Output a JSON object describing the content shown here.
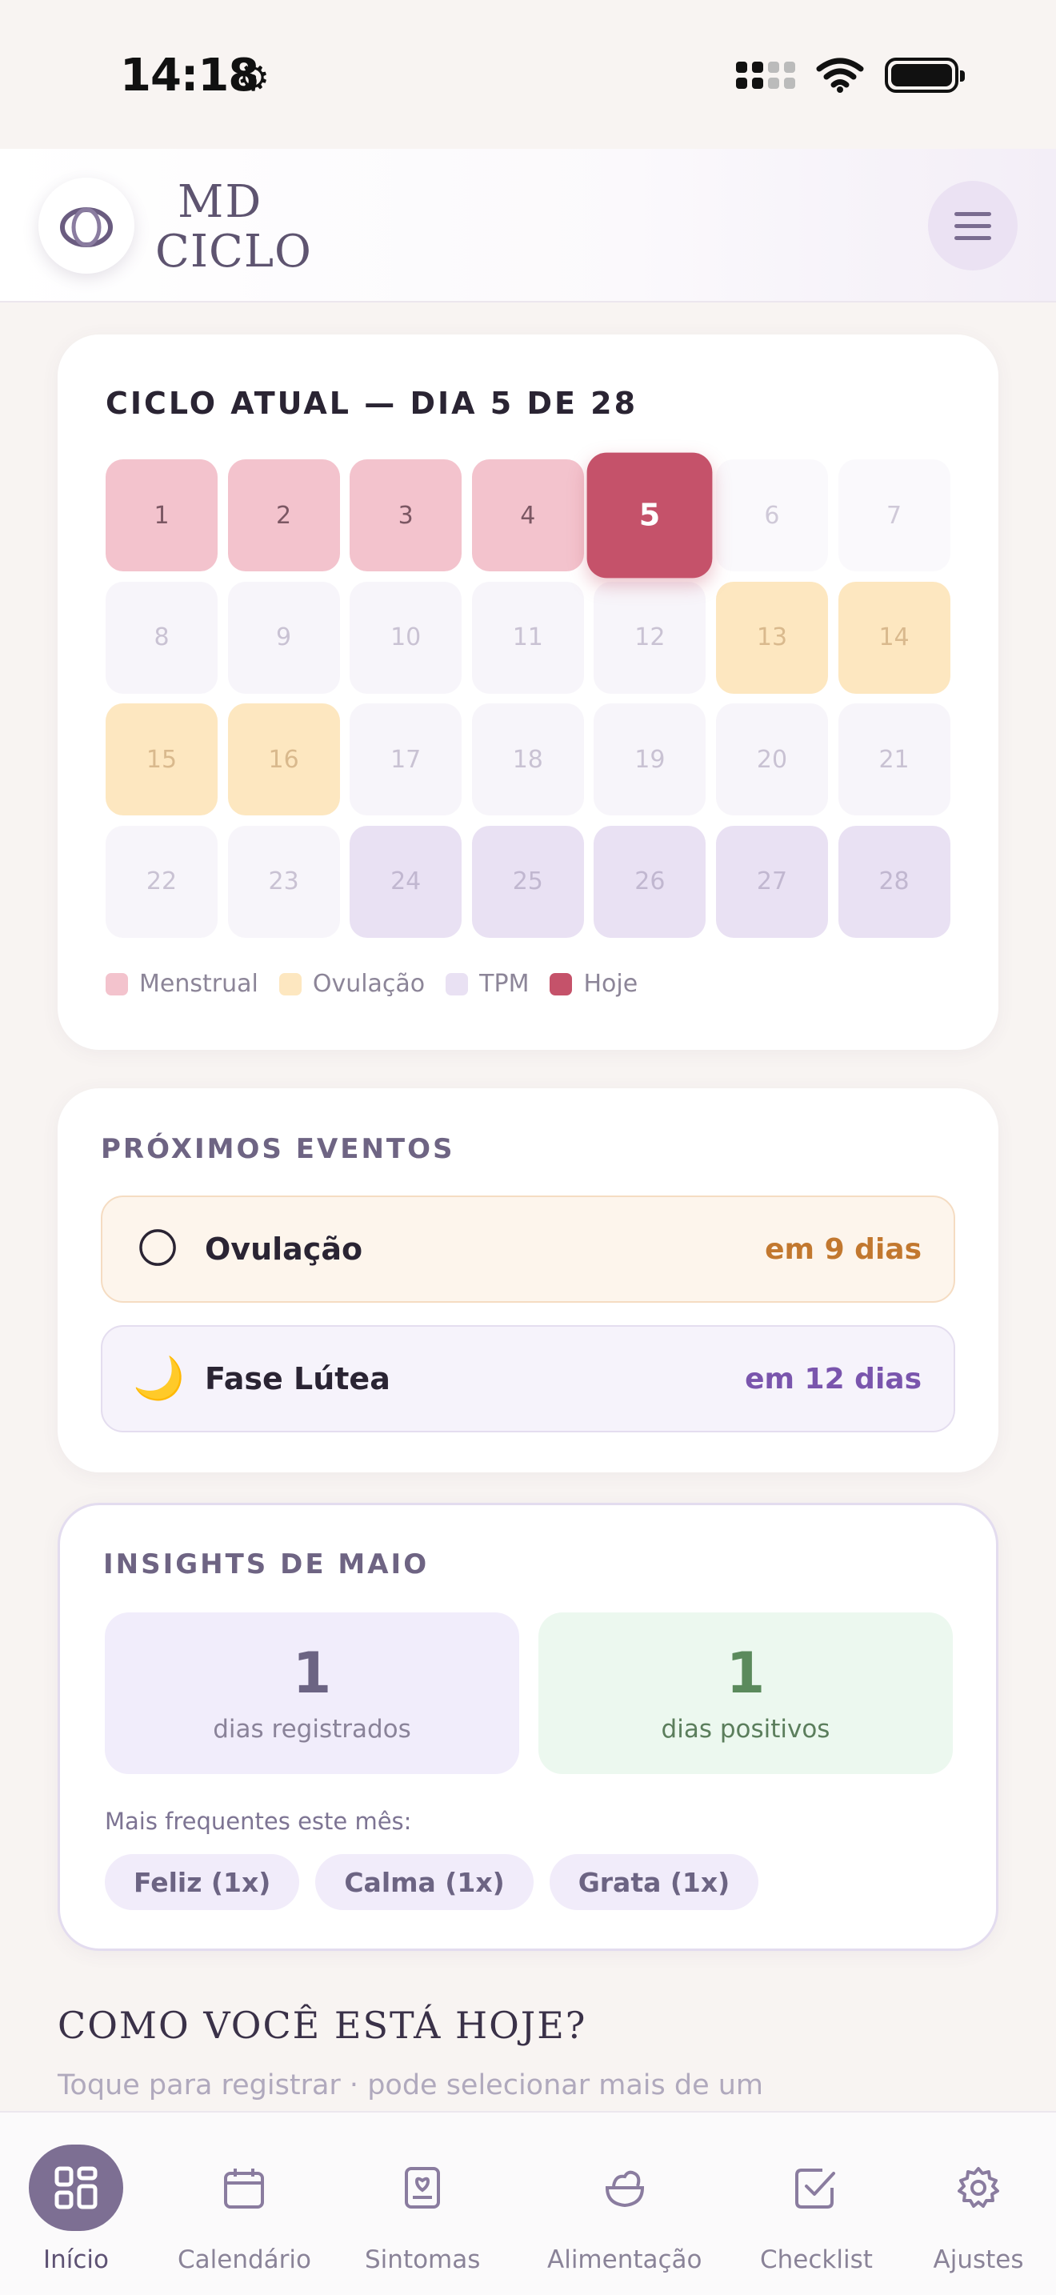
{
  "status_bar": {
    "time": "14:18"
  },
  "header": {
    "brand_line1": "MD",
    "brand_line2": "CICLO"
  },
  "cycle": {
    "title": "CICLO ATUAL — DIA 5 DE 28",
    "days": [
      {
        "n": "1",
        "phase": "menstrual"
      },
      {
        "n": "2",
        "phase": "menstrual"
      },
      {
        "n": "3",
        "phase": "menstrual"
      },
      {
        "n": "4",
        "phase": "menstrual"
      },
      {
        "n": "5",
        "phase": "today"
      },
      {
        "n": "6",
        "phase": "empty"
      },
      {
        "n": "7",
        "phase": "empty"
      },
      {
        "n": "8",
        "phase": "normal"
      },
      {
        "n": "9",
        "phase": "normal"
      },
      {
        "n": "10",
        "phase": "normal"
      },
      {
        "n": "11",
        "phase": "normal"
      },
      {
        "n": "12",
        "phase": "normal"
      },
      {
        "n": "13",
        "phase": "ovulation"
      },
      {
        "n": "14",
        "phase": "ovulation"
      },
      {
        "n": "15",
        "phase": "ovulation"
      },
      {
        "n": "16",
        "phase": "ovulation"
      },
      {
        "n": "17",
        "phase": "normal"
      },
      {
        "n": "18",
        "phase": "normal"
      },
      {
        "n": "19",
        "phase": "normal"
      },
      {
        "n": "20",
        "phase": "normal"
      },
      {
        "n": "21",
        "phase": "normal"
      },
      {
        "n": "22",
        "phase": "normal"
      },
      {
        "n": "23",
        "phase": "normal"
      },
      {
        "n": "24",
        "phase": "tpm"
      },
      {
        "n": "25",
        "phase": "tpm"
      },
      {
        "n": "26",
        "phase": "tpm"
      },
      {
        "n": "27",
        "phase": "tpm"
      },
      {
        "n": "28",
        "phase": "tpm"
      }
    ],
    "legend": [
      {
        "label": "Menstrual",
        "color": "#f3c3cd"
      },
      {
        "label": "Ovulação",
        "color": "#fde7c0"
      },
      {
        "label": "TPM",
        "color": "#e9e1f3"
      },
      {
        "label": "Hoje",
        "color": "#c5526a"
      }
    ]
  },
  "events": {
    "title": "PRÓXIMOS EVENTOS",
    "items": [
      {
        "icon": "full-moon-icon",
        "glyph": "🌕",
        "name": "Ovulação",
        "when": "em 9 dias"
      },
      {
        "icon": "crescent-moon-icon",
        "glyph": "🌙",
        "name": "Fase Lútea",
        "when": "em 12 dias"
      }
    ]
  },
  "insights": {
    "title": "INSIGHTS DE MAIO",
    "registered_value": "1",
    "registered_label": "dias registrados",
    "positive_value": "1",
    "positive_label": "dias positivos",
    "frequent_label": "Mais frequentes este mês:",
    "chips": [
      "Feliz (1x)",
      "Calma (1x)",
      "Grata (1x)"
    ]
  },
  "mood": {
    "title": "COMO VOCÊ ESTÁ HOJE?",
    "subtitle": "Toque para registrar · pode selecionar mais de um"
  },
  "nav": {
    "items": [
      {
        "label": "Início",
        "icon": "grid-icon",
        "active": true
      },
      {
        "label": "Calendário",
        "icon": "calendar-icon",
        "active": false
      },
      {
        "label": "Sintomas",
        "icon": "journal-icon",
        "active": false
      },
      {
        "label": "Alimentação",
        "icon": "salad-bowl-icon",
        "active": false
      },
      {
        "label": "Checklist",
        "icon": "checkbox-icon",
        "active": false
      },
      {
        "label": "Ajustes",
        "icon": "gear-icon",
        "active": false
      }
    ]
  }
}
